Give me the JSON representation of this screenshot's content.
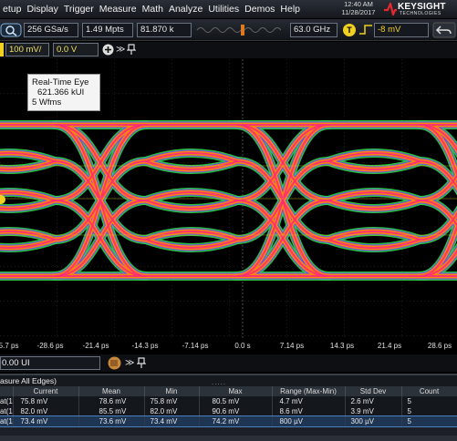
{
  "menu": {
    "items": [
      "etup",
      "Display",
      "Trigger",
      "Measure",
      "Math",
      "Analyze",
      "Utilities",
      "Demos",
      "Help"
    ],
    "time": "12:40 AM",
    "date": "11/28/2017",
    "brand": "KEYSIGHT",
    "brand_sub": "TECHNOLOGIES"
  },
  "toolbar": {
    "sample_rate": "256 GSa/s",
    "memory_depth": "1.49 Mpts",
    "frequency": "81.870 k",
    "bandwidth": "63.0 GHz",
    "trigger_badge": "T",
    "trigger_level": "-8 mV"
  },
  "vertical": {
    "scale": "100 mV/",
    "offset": "0.0 V"
  },
  "eye": {
    "title": "Real-Time Eye",
    "ui_count": "621.366 kUI",
    "waveforms": "5 Wfms",
    "colors": {
      "outer": "#2fd34a",
      "mid": "#7a3cff",
      "hot": "#ff8a00",
      "core": "#ff2a7a"
    }
  },
  "axis": {
    "ticks": [
      "-35.7 ps",
      "-28.6 ps",
      "-21.4 ps",
      "-14.3 ps",
      "-7.14 ps",
      "0.0 s",
      "7.14 ps",
      "14.3 ps",
      "21.4 ps",
      "28.6 ps"
    ]
  },
  "horizontal": {
    "position": "0.00 UI"
  },
  "measurements": {
    "header": "asure All Edges)",
    "columns": [
      "",
      "Current",
      "Mean",
      "Min",
      "Max",
      "Range (Max-Min)",
      "Std Dev",
      "Count"
    ],
    "rows": [
      [
        "at(1",
        "75.8 mV",
        "78.6 mV",
        "75.8 mV",
        "80.5 mV",
        "4.7 mV",
        "2.6 mV",
        "5"
      ],
      [
        "at(1",
        "82.0 mV",
        "85.5 mV",
        "82.0 mV",
        "90.6 mV",
        "8.6 mV",
        "3.9 mV",
        "5"
      ],
      [
        "at(1",
        "73.4 mV",
        "73.6 mV",
        "73.4 mV",
        "74.2 mV",
        "800 µV",
        "300 µV",
        "5"
      ]
    ]
  }
}
